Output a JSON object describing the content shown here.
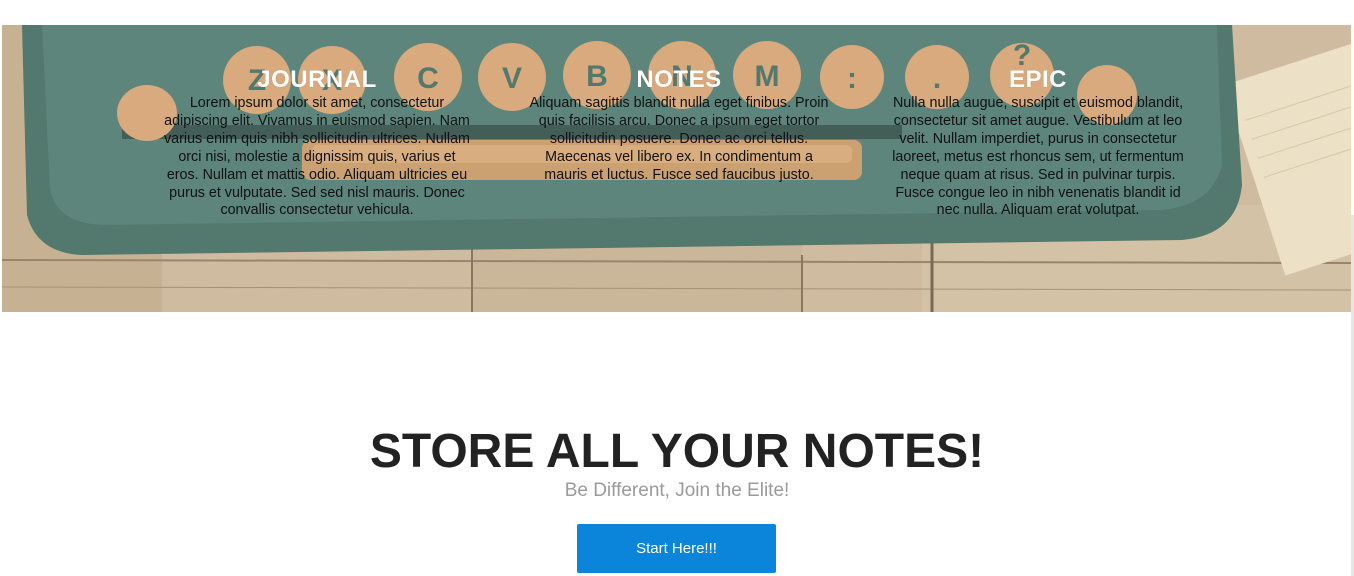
{
  "hero": {
    "columns": [
      {
        "title": "JOURNAL",
        "text": "Lorem ipsum dolor sit amet, consectetur adipiscing elit. Vivamus in euismod sapien. Nam varius enim quis nibh sollicitudin ultrices. Nullam orci nisi, molestie a dignissim quis, varius et eros. Nullam et mattis odio. Aliquam ultricies eu purus et vulputate. Sed sed nisl mauris. Donec convallis consectetur vehicula."
      },
      {
        "title": "NOTES",
        "text": "Aliquam sagittis blandit nulla eget finibus. Proin quis facilisis arcu. Donec a ipsum eget tortor sollicitudin posuere. Donec ac orci tellus. Maecenas vel libero ex. In condimentum a mauris et luctus. Fusce sed faucibus justo."
      },
      {
        "title": "EPIC",
        "text": "Nulla nulla augue, suscipit et euismod blandit, consectetur sit amet augue. Vestibulum at leo velit. Nullam imperdiet, purus in consectetur laoreet, metus est rhoncus sem, ut fermentum neque quam at risus. Sed in pulvinar turpis. Fusce congue leo in nibh venenatis blandit id nec nulla. Aliquam erat volutpat."
      }
    ],
    "keys": [
      "Z",
      "X",
      "C",
      "V",
      "B",
      "N",
      "M",
      ":",
      ".",
      "?"
    ]
  },
  "cta": {
    "headline": "STORE ALL YOUR NOTES!",
    "subheadline": "Be Different, Join the Elite!",
    "button_label": "Start Here!!!"
  },
  "colors": {
    "button": "#0a85d9",
    "headline": "#222222",
    "subheadline": "#9a9a9a"
  }
}
